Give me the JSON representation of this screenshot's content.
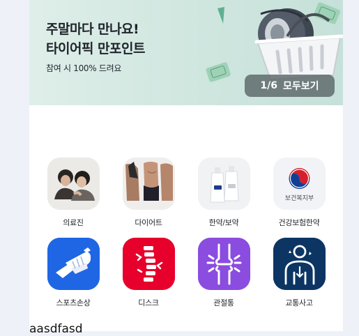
{
  "banner": {
    "title": "주말마다 만나요!\n타이어픽 만포인트",
    "subtitle": "참여 시 100% 드려요",
    "page_indicator": "1/6",
    "view_all_label": "모두보기"
  },
  "categories": [
    {
      "label": "의료진",
      "icon": "doctors-photo"
    },
    {
      "label": "다이어트",
      "icon": "body-photo"
    },
    {
      "label": "한약/보약",
      "icon": "medicine-pouch-photo"
    },
    {
      "label": "건강보험한약",
      "icon": "health-ministry-logo",
      "logo_text": "보건복지부"
    },
    {
      "label": "스포츠손상",
      "icon": "bandaged-hand-icon",
      "color": "#1f66e5"
    },
    {
      "label": "디스크",
      "icon": "spine-icon",
      "color": "#e6002b"
    },
    {
      "label": "관절통",
      "icon": "knee-joint-icon",
      "color": "#8b4ce0"
    },
    {
      "label": "교통사고",
      "icon": "body-injury-icon",
      "color": "#0c3564"
    }
  ],
  "stray_text": "aasdfasd"
}
